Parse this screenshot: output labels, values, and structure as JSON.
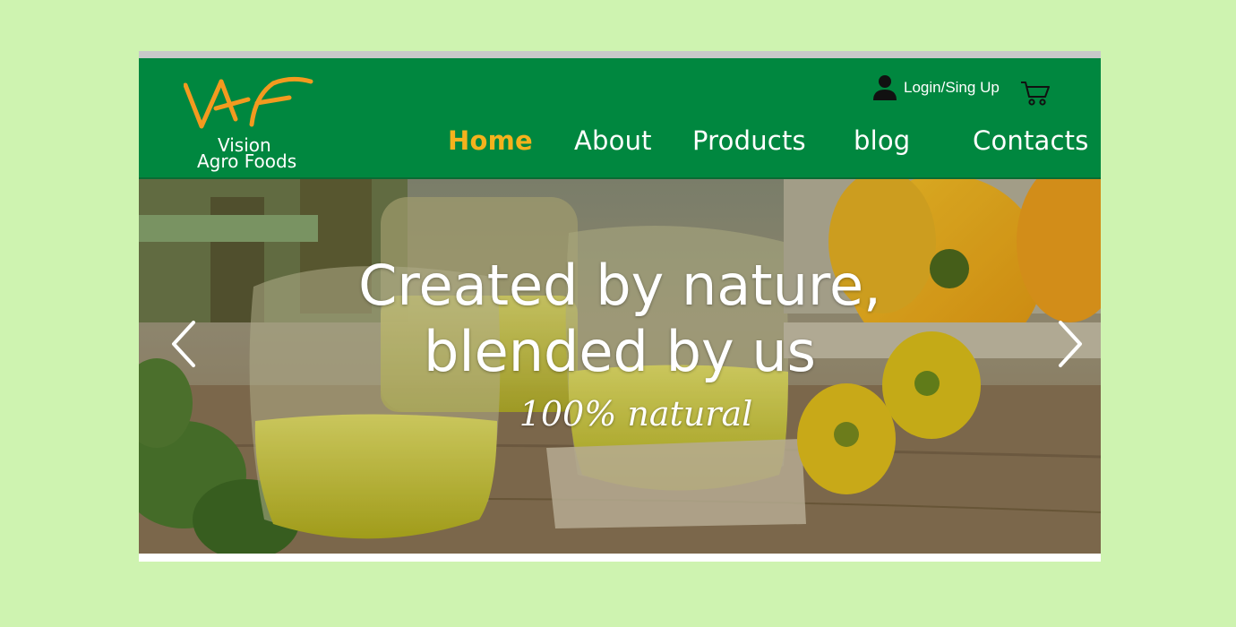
{
  "brand": {
    "logo_mark": "VAF",
    "line1": "Vision",
    "line2": "Agro Foods",
    "logo_color": "#f39a1f"
  },
  "account": {
    "login_label": "Login/Sing Up",
    "user_icon": "user-icon",
    "cart_icon": "cart-icon"
  },
  "nav": {
    "items": [
      {
        "label": "Home",
        "active": true
      },
      {
        "label": "About",
        "active": false
      },
      {
        "label": "Products",
        "active": false
      },
      {
        "label": "blog",
        "active": false
      },
      {
        "label": "Contacts",
        "active": false
      }
    ]
  },
  "hero": {
    "title_line1": "Created by nature,",
    "title_line2": "blended by us",
    "subtitle": "100% natural",
    "prev_icon": "chevron-left-icon",
    "next_icon": "chevron-right-icon"
  },
  "colors": {
    "page_bg": "#cef3b0",
    "header_green": "#00873f",
    "active_nav": "#f5b21d",
    "text": "#ffffff"
  }
}
